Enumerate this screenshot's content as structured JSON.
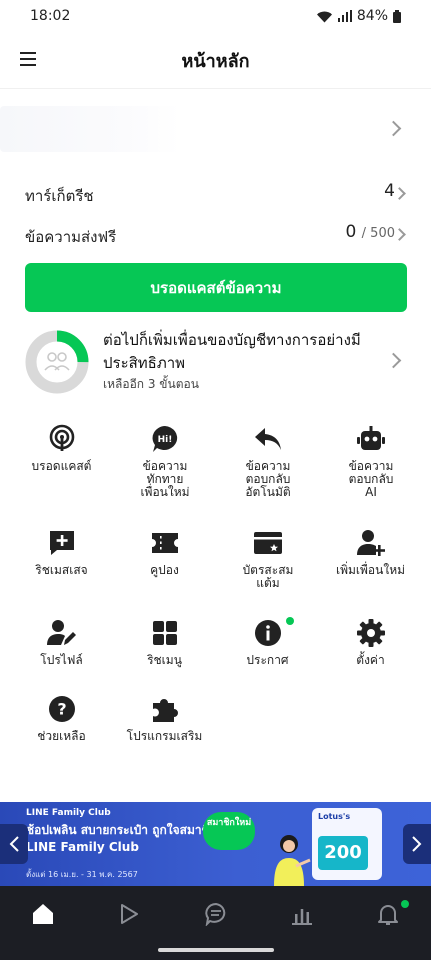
{
  "status_bar": {
    "time": "18:02",
    "battery": "84%"
  },
  "header": {
    "title": "หน้าหลัก"
  },
  "stats": {
    "targets": {
      "label": "ทาร์เก็ตรีช",
      "value": "4"
    },
    "free_messages": {
      "label": "ข้อความส่งฟรี",
      "value": "0",
      "limit": "/ 500"
    }
  },
  "broadcast_button": {
    "label": "บรอดแคสต์ข้อความ"
  },
  "progress": {
    "title": "ต่อไปก็เพิ่มเพื่อนของบัญชีทางการอย่างมีประสิทธิภาพ",
    "subtitle": "เหลืออีก 3 ขั้นตอน",
    "fraction": 0.25,
    "fill_color": "#06c755",
    "track_color": "#d9d9d9"
  },
  "grid": {
    "items": [
      {
        "label": "บรอดแคสต์",
        "icon": "broadcast-icon"
      },
      {
        "label": "ข้อความทักทายเพื่อนใหม่",
        "icon": "greeting-hi-icon"
      },
      {
        "label": "ข้อความตอบกลับอัตโนมัติ",
        "icon": "reply-arrow-icon"
      },
      {
        "label": "ข้อความตอบกลับ AI",
        "icon": "ai-robot-icon"
      },
      {
        "label": "ริชเมสเสจ",
        "icon": "rich-message-icon"
      },
      {
        "label": "คูปอง",
        "icon": "coupon-icon"
      },
      {
        "label": "บัตรสะสมแต้ม",
        "icon": "reward-card-icon"
      },
      {
        "label": "เพิ่มเพื่อนใหม่",
        "icon": "add-friend-icon"
      },
      {
        "label": "โปรไฟล์",
        "icon": "profile-edit-icon"
      },
      {
        "label": "ริชเมนู",
        "icon": "rich-menu-icon"
      },
      {
        "label": "ประกาศ",
        "icon": "info-icon"
      },
      {
        "label": "ตั้งค่า",
        "icon": "gear-icon"
      },
      {
        "label": "ช่วยเหลือ",
        "icon": "help-icon"
      },
      {
        "label": "โปรแกรมเสริม",
        "icon": "puzzle-icon"
      }
    ]
  },
  "banner": {
    "club": "LINE Family Club",
    "headline": "ช้อปเพลิน สบายกระเป๋า ถูกใจสมาชิก LINE Family Club",
    "dates": "ตั้งแต่ 16 เม.ย. - 31 พ.ค. 2567",
    "member_badge": "สมาชิกใหม่",
    "card_brand": "Lotus's",
    "card_value": "200"
  },
  "bottom_nav": {
    "items": [
      "home-icon",
      "play-icon",
      "chat-icon",
      "insights-icon",
      "notification-bell-icon"
    ],
    "active": "home-icon"
  }
}
